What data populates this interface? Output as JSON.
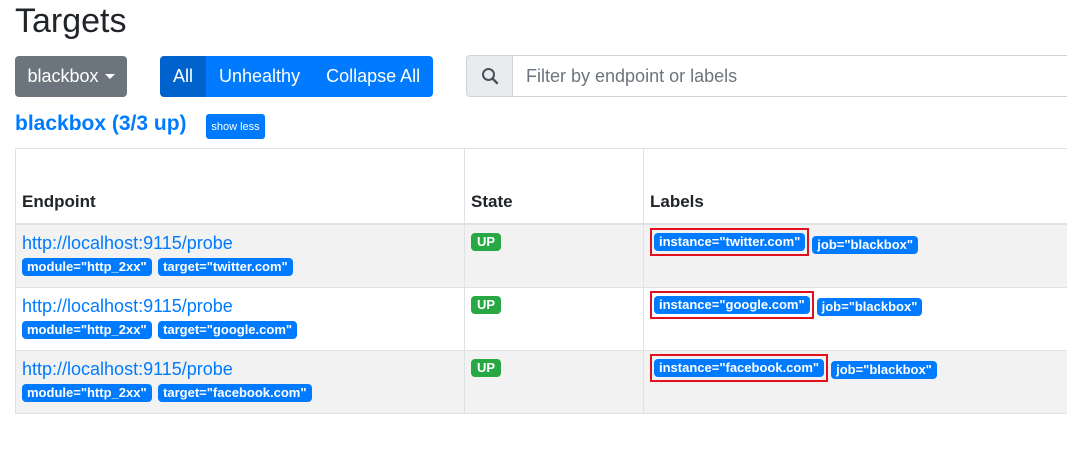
{
  "page": {
    "title": "Targets"
  },
  "controls": {
    "job_dropdown": "blackbox",
    "filters": [
      "All",
      "Unhealthy",
      "Collapse All"
    ],
    "search_placeholder": "Filter by endpoint or labels"
  },
  "group": {
    "title": "blackbox (3/3 up)",
    "show_less": "show less"
  },
  "table": {
    "headers": [
      "Endpoint",
      "State",
      "Labels"
    ],
    "rows": [
      {
        "endpoint": "http://localhost:9115/probe",
        "params": [
          "module=\"http_2xx\"",
          "target=\"twitter.com\""
        ],
        "state": "UP",
        "labels": [
          "instance=\"twitter.com\"",
          "job=\"blackbox\""
        ]
      },
      {
        "endpoint": "http://localhost:9115/probe",
        "params": [
          "module=\"http_2xx\"",
          "target=\"google.com\""
        ],
        "state": "UP",
        "labels": [
          "instance=\"google.com\"",
          "job=\"blackbox\""
        ]
      },
      {
        "endpoint": "http://localhost:9115/probe",
        "params": [
          "module=\"http_2xx\"",
          "target=\"facebook.com\""
        ],
        "state": "UP",
        "labels": [
          "instance=\"facebook.com\"",
          "job=\"blackbox\""
        ]
      }
    ]
  },
  "colors": {
    "primary": "#007bff",
    "secondary": "#6c757d",
    "success": "#28a745",
    "highlight": "#e0101e"
  }
}
